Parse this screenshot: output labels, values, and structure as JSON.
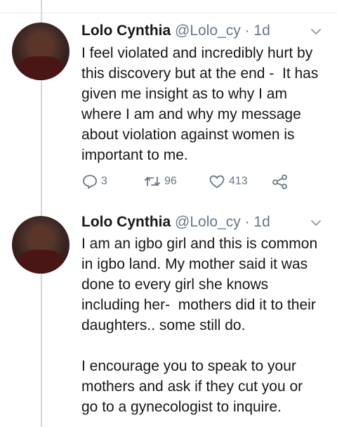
{
  "tweets": [
    {
      "name": "Lolo Cynthia",
      "handle": "@Lolo_cy",
      "dot": "·",
      "time": "1d",
      "text": "I feel violated and incredibly hurt by\nthis discovery but at the end -  It has\ngiven me insight as to why I am\nwhere I am and why my message\nabout violation against women is\nimportant to me.",
      "actions": {
        "replies": "3",
        "retweets": "96",
        "likes": "413"
      }
    },
    {
      "name": "Lolo Cynthia",
      "handle": "@Lolo_cy",
      "dot": "·",
      "time": "1d",
      "text": "I am an igbo girl and this is common\nin igbo land. My mother said it was\ndone to every girl she knows\nincluding her-  mothers did it to their\ndaughters.. some still do.\n\nI encourage you to speak to your\nmothers and ask if they cut you or\ngo to a gynecologist to inquire."
    }
  ],
  "icons": {
    "reply": "reply-icon",
    "retweet": "retweet-icon",
    "like": "heart-icon",
    "share": "share-icon",
    "menu": "chevron-down-icon"
  },
  "colors": {
    "text": "#14171a",
    "muted": "#657786",
    "line": "#cfd9de"
  }
}
